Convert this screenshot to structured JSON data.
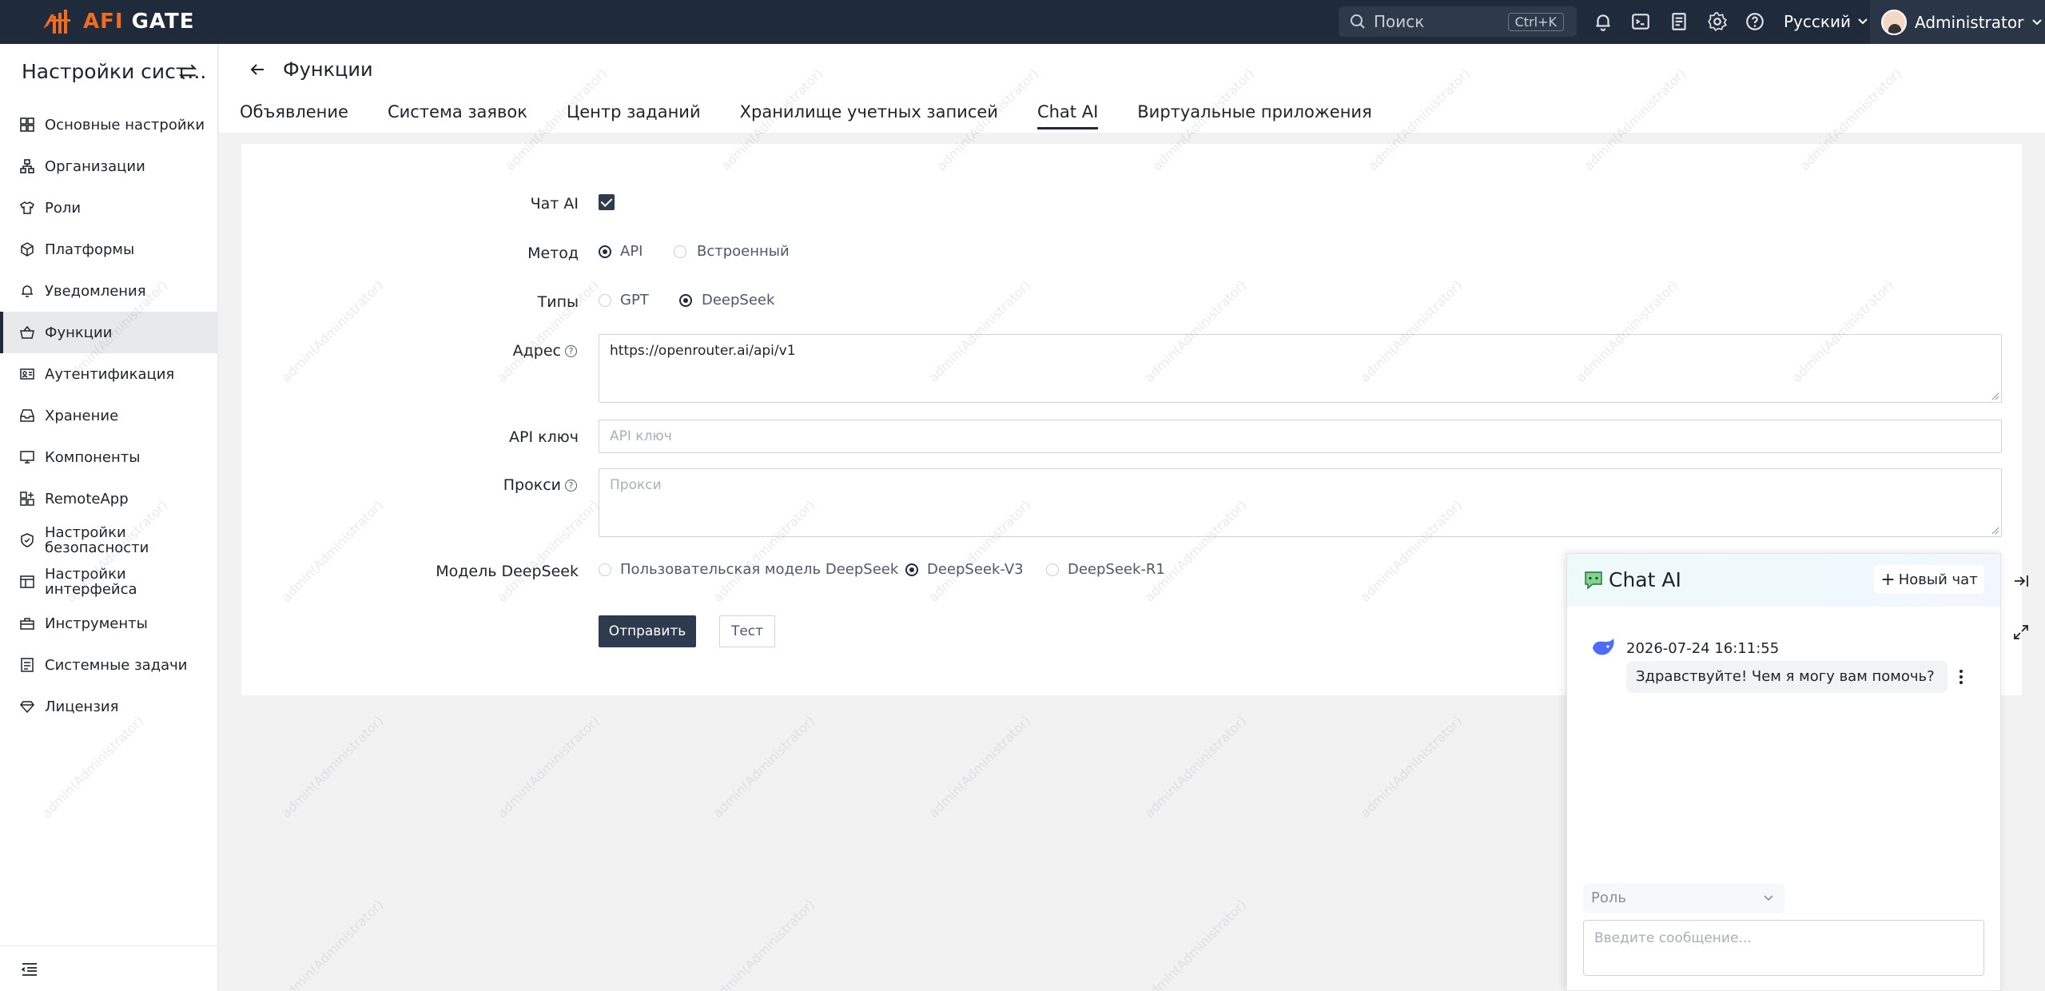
{
  "topbar": {
    "logo_text_afi": "AFI",
    "logo_text_gate": "GATE",
    "search_placeholder": "Поиск",
    "search_shortcut": "Ctrl+K",
    "language": "Русский",
    "user_name": "Administrator"
  },
  "sidebar": {
    "title": "Настройки сист...",
    "items": [
      {
        "label": "Основные настройки",
        "icon": "grid-icon"
      },
      {
        "label": "Организации",
        "icon": "org-icon"
      },
      {
        "label": "Роли",
        "icon": "shirt-icon"
      },
      {
        "label": "Платформы",
        "icon": "cube-icon"
      },
      {
        "label": "Уведомления",
        "icon": "bell-icon"
      },
      {
        "label": "Функции",
        "icon": "basket-icon",
        "active": true
      },
      {
        "label": "Аутентификация",
        "icon": "id-card-icon"
      },
      {
        "label": "Хранение",
        "icon": "inbox-icon"
      },
      {
        "label": "Компоненты",
        "icon": "monitor-icon"
      },
      {
        "label": "RemoteApp",
        "icon": "apps-icon"
      },
      {
        "label": "Настройки безопасности",
        "icon": "shield-icon"
      },
      {
        "label": "Настройки интерфейса",
        "icon": "layout-icon"
      },
      {
        "label": "Инструменты",
        "icon": "tools-icon"
      },
      {
        "label": "Системные задачи",
        "icon": "task-icon"
      },
      {
        "label": "Лицензия",
        "icon": "diamond-icon"
      }
    ]
  },
  "header": {
    "title": "Функции",
    "tabs": [
      {
        "label": "Объявление"
      },
      {
        "label": "Система заявок"
      },
      {
        "label": "Центр заданий"
      },
      {
        "label": "Хранилище учетных записей"
      },
      {
        "label": "Chat AI",
        "active": true
      },
      {
        "label": "Виртуальные приложения"
      }
    ]
  },
  "form": {
    "chat_ai_label": "Чат AI",
    "chat_ai_checked": true,
    "method_label": "Метод",
    "method_options": [
      "API",
      "Встроенный"
    ],
    "method_selected": "API",
    "types_label": "Типы",
    "types_options": [
      "GPT",
      "DeepSeek"
    ],
    "types_selected": "DeepSeek",
    "address_label": "Адрес",
    "address_value": "https://openrouter.ai/api/v1",
    "api_key_label": "API ключ",
    "api_key_placeholder": "API ключ",
    "proxy_label": "Прокси",
    "proxy_placeholder": "Прокси",
    "model_label": "Модель DeepSeek",
    "model_options": [
      "Пользовательская модель DeepSeek",
      "DeepSeek-V3",
      "DeepSeek-R1"
    ],
    "model_selected": "DeepSeek-V3",
    "submit_label": "Отправить",
    "test_label": "Тест"
  },
  "chat": {
    "title": "Chat AI",
    "new_chat_label": "Новый чат",
    "message_time": "2026-07-24 16:11:55",
    "message_text": "Здравствуйте! Чем я могу вам помочь?",
    "role_placeholder": "Роль",
    "input_placeholder": "Введите сообщение..."
  },
  "watermark": "admin(Administrator)",
  "colors": {
    "topbar": "#1f2b3a",
    "accent": "#2d3b4e",
    "brand_orange": "#f26b21"
  }
}
